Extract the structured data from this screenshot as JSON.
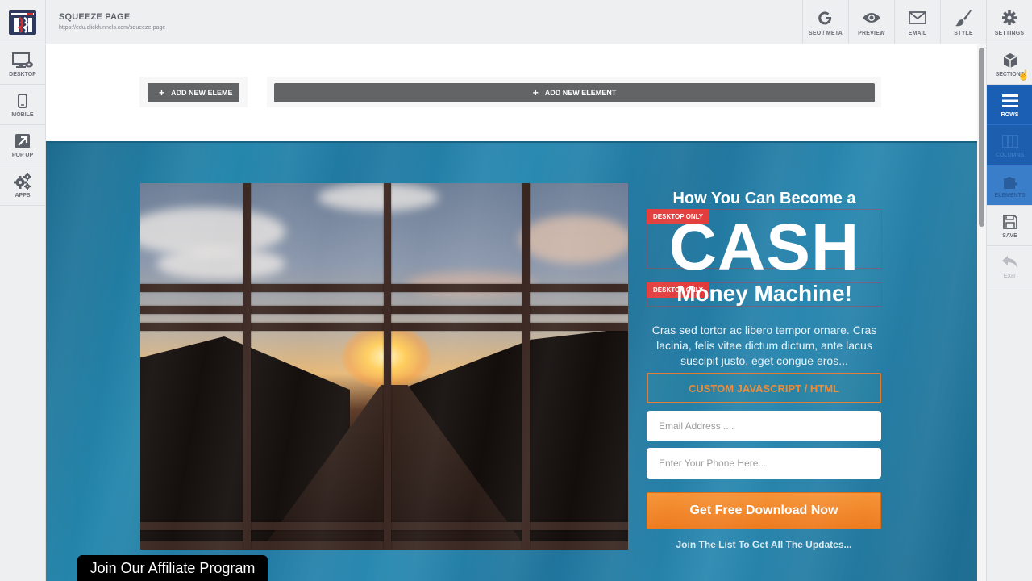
{
  "header": {
    "page_title": "SQUEEZE PAGE",
    "page_url": "https://edu.clickfunnels.com/squeeze-page",
    "actions": [
      {
        "label": "SEO / META",
        "icon": "google-icon"
      },
      {
        "label": "PREVIEW",
        "icon": "eye-icon"
      },
      {
        "label": "EMAIL",
        "icon": "envelope-icon"
      },
      {
        "label": "STYLE",
        "icon": "paintbrush-icon"
      },
      {
        "label": "SETTINGS",
        "icon": "gear-icon"
      }
    ]
  },
  "left_sidebar": {
    "items": [
      {
        "label": "DESKTOP",
        "icon": "desktop-icon"
      },
      {
        "label": "MOBILE",
        "icon": "mobile-icon"
      },
      {
        "label": "POP UP",
        "icon": "popup-arrow-icon"
      },
      {
        "label": "APPS",
        "icon": "gears-icon"
      }
    ]
  },
  "right_sidebar": {
    "items": [
      {
        "label": "SECTIONS",
        "icon": "cube-icon",
        "state": "normal"
      },
      {
        "label": "ROWS",
        "icon": "rows-icon",
        "state": "active"
      },
      {
        "label": "COLUMNS",
        "icon": "columns-icon",
        "state": "dim"
      },
      {
        "label": "ELEMENTS",
        "icon": "puzzle-icon",
        "state": "light"
      },
      {
        "label": "SAVE",
        "icon": "floppy-icon",
        "state": "normal"
      },
      {
        "label": "EXIT",
        "icon": "undo-icon",
        "state": "disabled"
      }
    ]
  },
  "canvas": {
    "add_element_small": "ADD NEW ELEME",
    "add_element_large": "ADD NEW ELEMENT",
    "headline_top": "How You Can Become a",
    "badge_1": "DESKTOP ONLY",
    "headline_main": "CASH",
    "badge_2": "DESKTOP ONLY",
    "headline_bottom": "Money Machine!",
    "body_text": "Cras sed tortor ac libero tempor ornare. Cras lacinia, felis vitae dictum dictum, ante lacus suscipit justo, eget congue eros...",
    "custom_js_label": "CUSTOM JAVASCRIPT / HTML",
    "email_placeholder": "Email Address ....",
    "phone_placeholder": "Enter Your Phone Here...",
    "cta_label": "Get Free Download Now",
    "sub_cta": "Join The List To Get All The Updates...",
    "image_description": "Sunset over highway through metal fence grid"
  },
  "affiliate_bar": {
    "label": "Join Our Affiliate Program"
  },
  "colors": {
    "accent_blue": "#1a5fb4",
    "cta_orange": "#ee7a1e",
    "badge_red": "#e23a3a",
    "section_bg": "#2587ad"
  }
}
